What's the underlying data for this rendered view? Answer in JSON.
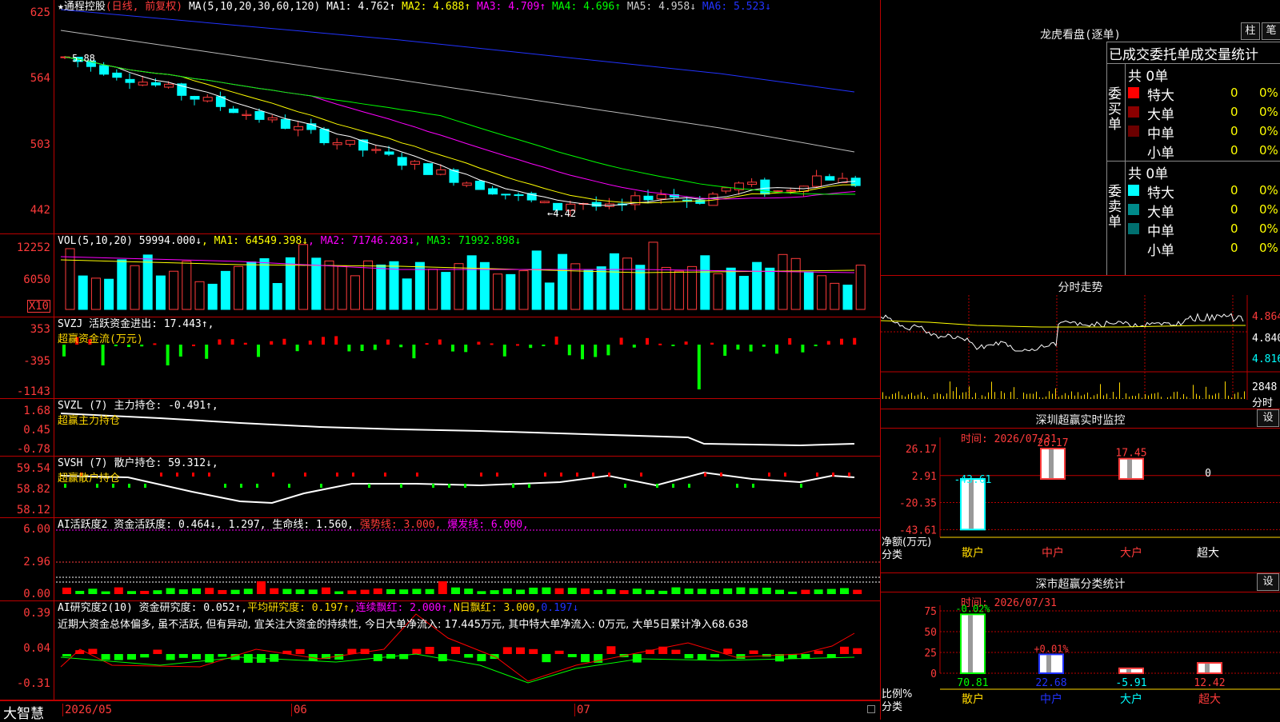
{
  "main": {
    "title": "★通程控股",
    "period": "(日线, 前复权)",
    "ma_label": "MA(5,10,20,30,60,120)",
    "ma": [
      {
        "name": "MA1:",
        "value": "4.762↑",
        "color": "#ffffff"
      },
      {
        "name": "MA2:",
        "value": "4.688↑",
        "color": "#ffff00"
      },
      {
        "name": "MA3:",
        "value": "4.709↑",
        "color": "#ff00ff"
      },
      {
        "name": "MA4:",
        "value": "4.696↑",
        "color": "#00ff00"
      },
      {
        "name": "MA5:",
        "value": "4.958↓",
        "color": "#cccccc"
      },
      {
        "name": "MA6:",
        "value": "5.523↓",
        "color": "#2233ff"
      }
    ],
    "ticks": [
      "625",
      "564",
      "503",
      "442"
    ],
    "high_label": "5.88",
    "low_label": "←4.42"
  },
  "vol": {
    "header": "VOL(5,10,20)",
    "value": "59994.000↓",
    "ma": [
      {
        "name": "MA1:",
        "value": "64549.398↓",
        "color": "#ffff00"
      },
      {
        "name": "MA2:",
        "value": "71746.203↓",
        "color": "#ff00ff"
      },
      {
        "name": "MA3:",
        "value": "71992.898↓",
        "color": "#00ff00"
      }
    ],
    "ticks": [
      "12252",
      "6050"
    ],
    "unit": "X10"
  },
  "svzj": {
    "header": "SVZJ  活跃资金进出: 17.443↑,",
    "sub": "超赢资金流(万元)",
    "ticks": [
      "353",
      "-395",
      "-1143"
    ]
  },
  "svzl": {
    "header": "SVZL (7) 主力持仓: -0.491↑,",
    "sub": "超赢主力持仓",
    "ticks": [
      "1.68",
      "0.45",
      "-0.78"
    ]
  },
  "svsh": {
    "header": "SVSH (7) 散户持仓: 59.312↓,",
    "sub": "超赢散户持仓",
    "ticks": [
      "59.54",
      "58.82",
      "58.12"
    ]
  },
  "ai_active": {
    "header": "AI活跃度2 资金活跃度: 0.464↓, 1.297, 生命线: 1.560,",
    "strong": "强势线: 3.000,",
    "burst": "爆发线: 6.000,",
    "ticks": [
      "6.00",
      "2.96",
      "0.00"
    ]
  },
  "ai_research": {
    "label1": "AI研究度2(10) 资金研究度: 0.052↑,",
    "label2": "平均研究度: 0.197↑,",
    "label3": "连续飘红: 2.000↑,",
    "label4": "N日飘红: 3.000,",
    "label5": "0.197↓",
    "comment": "近期大资金总体偏多, 虽不活跃, 但有异动, 宜关注大资金的持续性, 今日大单净流入: 17.445万元, 其中特大单净流入: 0万元, 大单5日累计净入68.638",
    "ticks": [
      "0.39",
      "0.04",
      "-0.31"
    ]
  },
  "bottom": {
    "brand": "大智慧",
    "dates": [
      "2026/05",
      "06",
      "07"
    ]
  },
  "dragon": {
    "title": "龙虎看盘(逐单)",
    "btn1": "柱",
    "btn2": "笔",
    "tabs": "已成交委托单成交量统计",
    "buy_label": "委买单",
    "sell_label": "委卖单",
    "buy_total": "共 0单",
    "sell_total": "共 0单",
    "buy_rows": [
      {
        "label": "特大",
        "count": "0",
        "pct": "0%",
        "color": "#ff0000"
      },
      {
        "label": "大单",
        "count": "0",
        "pct": "0%",
        "color": "#8b0000"
      },
      {
        "label": "中单",
        "count": "0",
        "pct": "0%",
        "color": "#6b0000"
      },
      {
        "label": "小单",
        "count": "0",
        "pct": "0%",
        "color": ""
      }
    ],
    "sell_rows": [
      {
        "label": "特大",
        "count": "0",
        "pct": "0%",
        "color": "#00ffff"
      },
      {
        "label": "大单",
        "count": "0",
        "pct": "0%",
        "color": "#008b8b"
      },
      {
        "label": "中单",
        "count": "0",
        "pct": "0%",
        "color": "#007070"
      },
      {
        "label": "小单",
        "count": "0",
        "pct": "0%",
        "color": ""
      }
    ]
  },
  "intraday": {
    "title": "分时走势",
    "prices": [
      "4.864",
      "4.840",
      "4.816"
    ],
    "vol": "2848",
    "vol_label": "分时"
  },
  "sz_monitor": {
    "title": "深圳超赢实时监控",
    "btn": "设",
    "time": "时间: 2026/07/31",
    "ticks": [
      "26.17",
      "2.91",
      "-20.35",
      "-43.61"
    ],
    "net_label": "净额(万元)",
    "cat_label": "分类",
    "categories": [
      "散户",
      "中户",
      "大户",
      "超大"
    ],
    "values": [
      "-43.61",
      "26.17",
      "17.45",
      "0"
    ]
  },
  "sz_class": {
    "title": "深市超赢分类统计",
    "btn": "设",
    "time": "时间: 2026/07/31",
    "ticks": [
      "75",
      "50",
      "25",
      "0"
    ],
    "ratio_label": "比例%",
    "cat_label": "分类",
    "categories": [
      "散户",
      "中户",
      "大户",
      "超大"
    ],
    "bar_values": [
      "70.81",
      "22.68",
      "-5.91",
      "12.42"
    ],
    "bar_labels": [
      "-0.02%",
      "+0.01%",
      "",
      ""
    ]
  },
  "colors": {
    "up": "#ff3b3b",
    "down": "#00ffff",
    "grid": "#b00000",
    "yellow": "#ffd800"
  }
}
